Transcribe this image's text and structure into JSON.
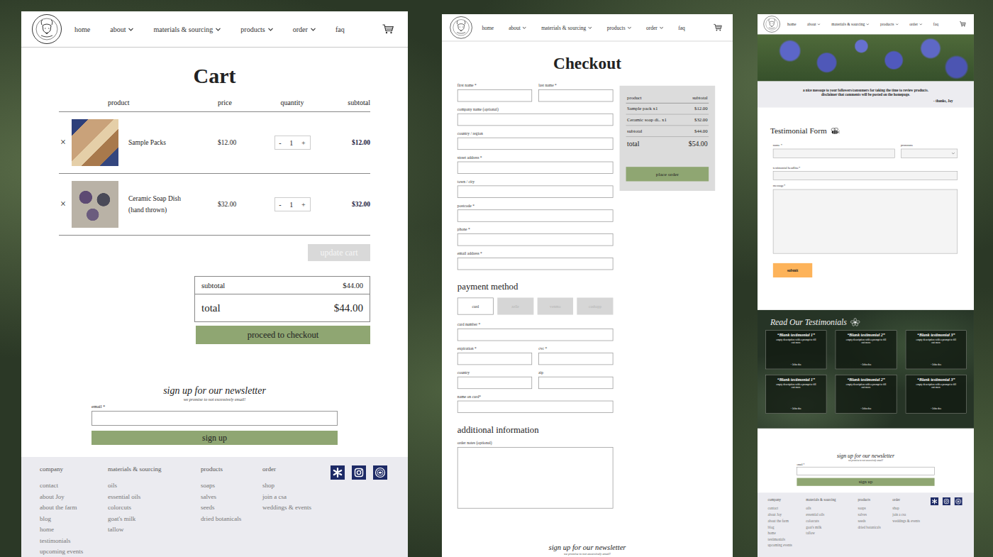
{
  "nav": {
    "items": [
      {
        "label": "home",
        "dropdown": false
      },
      {
        "label": "about",
        "dropdown": true
      },
      {
        "label": "materials & sourcing",
        "dropdown": true
      },
      {
        "label": "products",
        "dropdown": true
      },
      {
        "label": "order",
        "dropdown": true
      },
      {
        "label": "faq",
        "dropdown": false
      }
    ]
  },
  "cart": {
    "title": "Cart",
    "columns": [
      "product",
      "price",
      "quantity",
      "subtotal"
    ],
    "rows": [
      {
        "remove": "×",
        "name_lines": [
          "Sample Packs"
        ],
        "price": "$12.00",
        "minus": "-",
        "quantity": "1",
        "plus": "+",
        "subtotal": "$12.00"
      },
      {
        "remove": "×",
        "name_lines": [
          "Ceramic Soap Dish",
          "(hand thrown)"
        ],
        "price": "$32.00",
        "minus": "-",
        "quantity": "1",
        "plus": "+",
        "subtotal": "$32.00"
      }
    ],
    "update_button": {
      "label": "update cart",
      "disabled": true
    },
    "totals": [
      {
        "label": "subtotal",
        "value": "$44.00",
        "kind": "subtotal"
      },
      {
        "label": "total",
        "value": "$44.00",
        "kind": "total"
      }
    ],
    "checkout_button": "proceed to checkout"
  },
  "checkout": {
    "title": "Checkout",
    "billing_rows": [
      [
        "first name *",
        "last name *"
      ],
      [
        "company name (optional)"
      ],
      [
        "country / region"
      ],
      [
        "street address *"
      ],
      [
        "town / city"
      ],
      [
        "postcode *"
      ],
      [
        "phone *"
      ],
      [
        "email address *"
      ]
    ],
    "payment_heading": "payment method",
    "payment_methods": [
      {
        "label": "card",
        "selected": true
      },
      {
        "label": "zelle",
        "selected": false
      },
      {
        "label": "venmo",
        "selected": false
      },
      {
        "label": "cashapp",
        "selected": false
      }
    ],
    "card_rows": [
      [
        "card number *"
      ],
      [
        "expiration *",
        "cvc *"
      ],
      [
        "country",
        "zip"
      ],
      [
        "name on card*"
      ]
    ],
    "additional_heading": "additional information",
    "notes_label": "order notes (optional)",
    "summary": {
      "columns": [
        "product",
        "subtotal"
      ],
      "rows": [
        {
          "label": "Sample pack x1",
          "value": "$12.00",
          "kind": "item"
        },
        {
          "label": "Ceramic soap di.. x1",
          "value": "$32.00",
          "kind": "item"
        },
        {
          "label": "subtotal",
          "value": "$44.00",
          "kind": "subtotal"
        },
        {
          "label": "total",
          "value": "$54.00",
          "kind": "total"
        }
      ],
      "button": "place order"
    }
  },
  "testimonials": {
    "message": "a nice message to your followers/consumers for taking the time to review products. disclaimer that comments will be posted on the homepage.",
    "signature": "- thanks, Joy",
    "form_title": "Testimonial Form",
    "fields": {
      "name": "name *",
      "pronouns": "pronouns",
      "headline": "testimonial headline*",
      "message": "message*"
    },
    "submit": "submit",
    "read_title": "Read Our Testimonials",
    "cards": [
      {
        "title": "“Blank testimonial 1”",
        "description": "empty description with a prompt to fill out more",
        "author": "- John doe"
      },
      {
        "title": "“Blank testimonial 2”",
        "description": "empty description with a prompt to fill out more",
        "author": "- John doe"
      },
      {
        "title": "“Blank testimonial 3”",
        "description": "empty description with a prompt to fill out more",
        "author": "- John doe"
      },
      {
        "title": "“Blank testimonial 1”",
        "description": "empty description with a prompt to fill out more",
        "author": "- John doe"
      },
      {
        "title": "“Blank testimonial 2”",
        "description": "empty description with a prompt to fill out more",
        "author": "- John doe"
      },
      {
        "title": "“Blank testimonial 3”",
        "description": "empty description with a prompt to fill out more",
        "author": "- John doe"
      }
    ]
  },
  "newsletter": {
    "title": "sign up for our newsletter",
    "subtitle": "we promise to not excessively email!",
    "email_label": "email *",
    "button": "sign up"
  },
  "footer": {
    "columns": [
      {
        "heading": "company",
        "links": [
          "contact",
          "about Joy",
          "about the farm",
          "blog",
          "home",
          "testimonials",
          "upcoming events"
        ]
      },
      {
        "heading": "materials & sourcing",
        "links": [
          "oils",
          "essential oils",
          "colorcuts",
          "goat's milk",
          "tallow"
        ]
      },
      {
        "heading": "products",
        "links": [
          "soaps",
          "salves",
          "seeds",
          "dried botanicals"
        ]
      },
      {
        "heading": "order",
        "links": [
          "shop",
          "join a csa",
          "weddings & events"
        ]
      }
    ]
  }
}
